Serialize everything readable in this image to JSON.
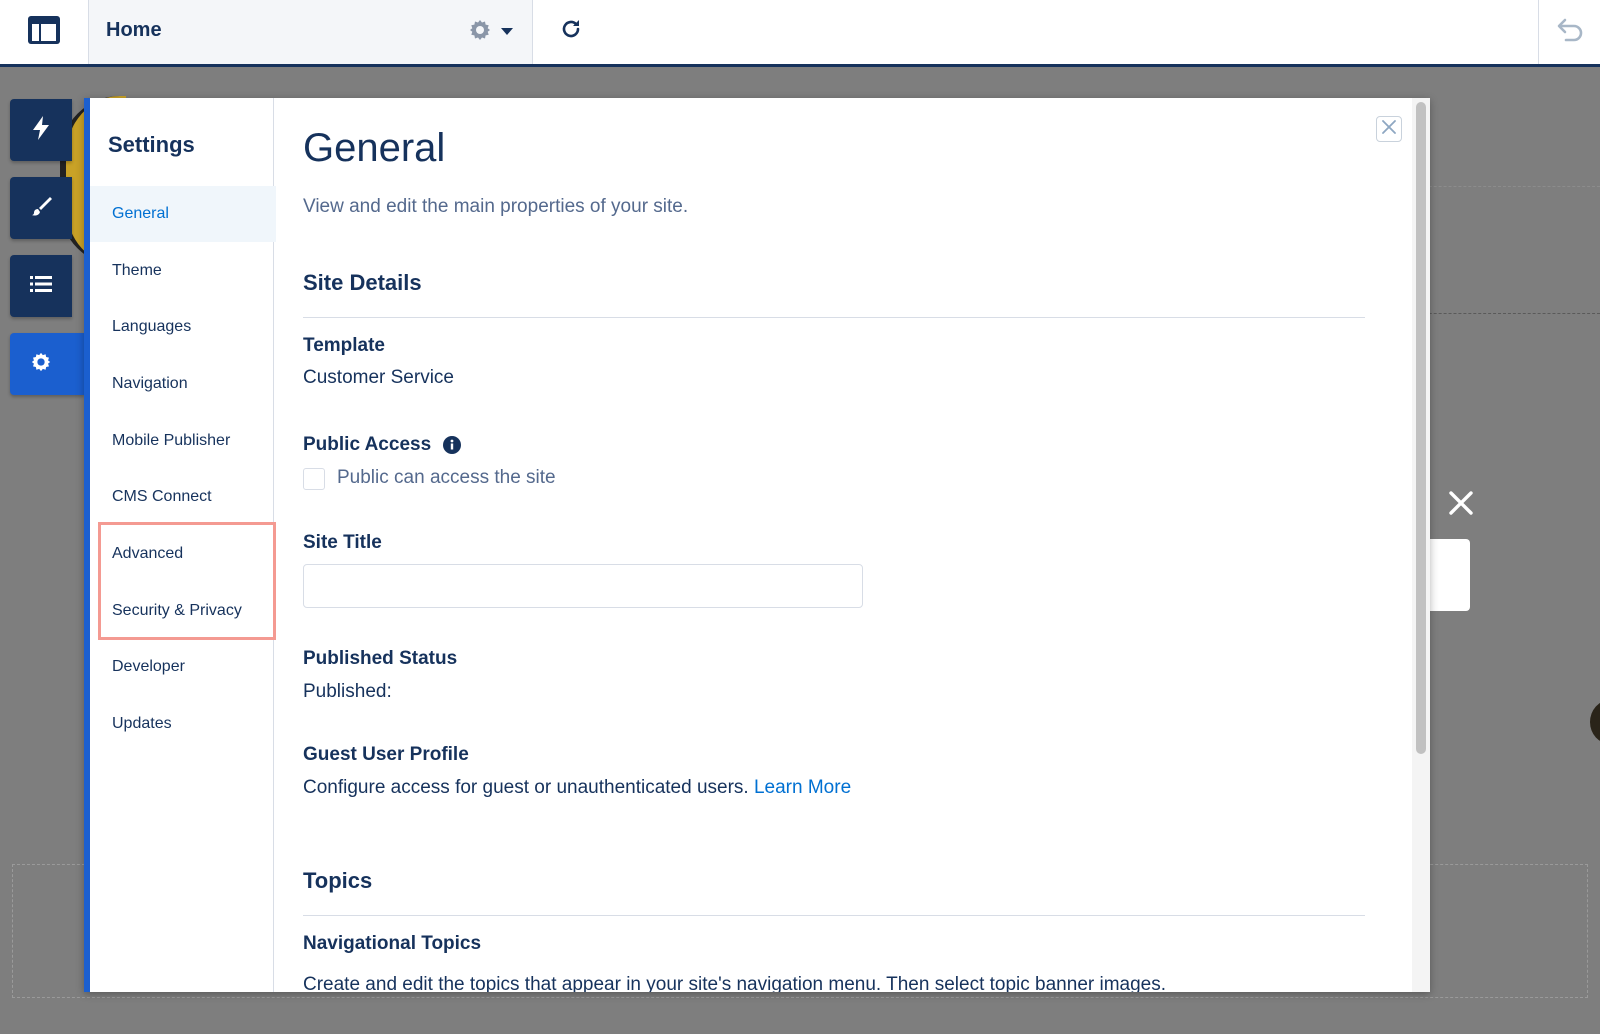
{
  "topbar": {
    "page_name": "Home"
  },
  "settings": {
    "title": "Settings",
    "nav_items": [
      {
        "label": "General",
        "active": true
      },
      {
        "label": "Theme"
      },
      {
        "label": "Languages"
      },
      {
        "label": "Navigation"
      },
      {
        "label": "Mobile Publisher"
      },
      {
        "label": "CMS Connect"
      },
      {
        "label": "Advanced"
      },
      {
        "label": "Security & Privacy"
      },
      {
        "label": "Developer"
      },
      {
        "label": "Updates"
      }
    ]
  },
  "general": {
    "heading": "General",
    "subtitle": "View and edit the main properties of your site.",
    "site_details_heading": "Site Details",
    "template_label": "Template",
    "template_value": "Customer Service",
    "public_access_label": "Public Access",
    "public_access_checkbox_label": "Public can access the site",
    "public_access_checked": false,
    "site_title_label": "Site Title",
    "site_title_value": "",
    "published_status_label": "Published Status",
    "published_status_value": "Published:",
    "guest_user_profile_label": "Guest User Profile",
    "guest_user_profile_text": "Configure access for guest or unauthenticated users.",
    "learn_more_link": "Learn More",
    "topics_heading": "Topics",
    "navigational_topics_label": "Navigational Topics",
    "navigational_topics_text": "Create and edit the topics that appear in your site's navigation menu. Then select topic banner images."
  },
  "colors": {
    "navy": "#16325c",
    "brand_blue": "#1b5fcf",
    "link_blue": "#0070d2",
    "highlight": "#f49a92"
  },
  "icons": [
    "app-layout-icon",
    "gear-icon",
    "caret-down-icon",
    "refresh-icon",
    "undo-icon",
    "lightning-icon",
    "brush-icon",
    "list-icon",
    "settings-gear-icon",
    "close-icon",
    "info-icon"
  ]
}
